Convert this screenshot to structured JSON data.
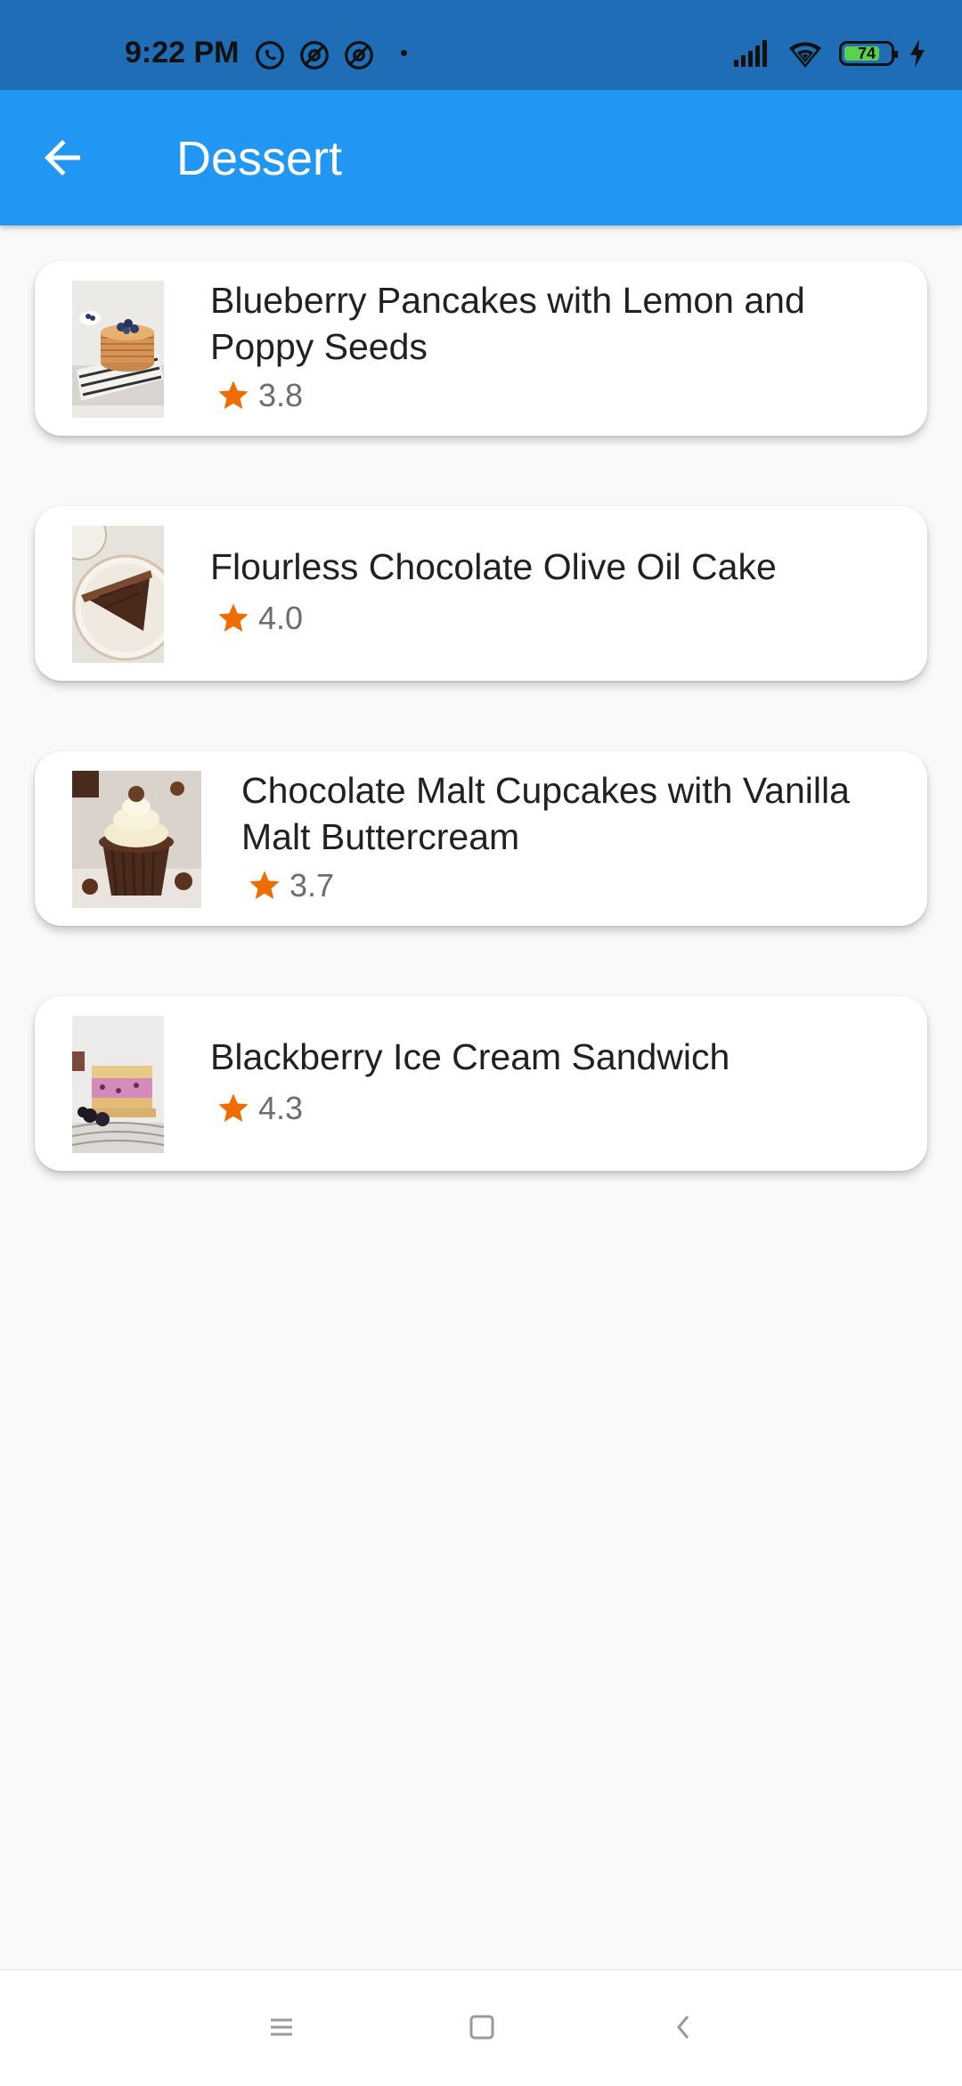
{
  "status_bar": {
    "time": "9:22 PM",
    "battery_level": "74",
    "icons": [
      "whatsapp-icon",
      "at-icon",
      "at-icon",
      "signal-icon",
      "wifi-icon",
      "battery-icon",
      "charging-icon"
    ]
  },
  "app_bar": {
    "title": "Dessert",
    "back_icon": "arrow-left-icon"
  },
  "recipes": [
    {
      "title": "Blueberry Pancakes with Lemon and Poppy Seeds",
      "rating": "3.8",
      "image": "pancakes-thumbnail"
    },
    {
      "title": "Flourless Chocolate Olive Oil Cake",
      "rating": "4.0",
      "image": "chocolate-cake-thumbnail"
    },
    {
      "title": "Chocolate Malt Cupcakes with Vanilla Malt Buttercream",
      "rating": "3.7",
      "image": "cupcake-thumbnail"
    },
    {
      "title": "Blackberry Ice Cream Sandwich",
      "rating": "4.3",
      "image": "ice-cream-sandwich-thumbnail"
    }
  ],
  "colors": {
    "status_bar": "#1f6db6",
    "app_bar": "#2196f3",
    "star": "#ef6c00",
    "background": "#f9f9f9"
  },
  "nav_bar": {
    "icons": [
      "menu-icon",
      "home-icon",
      "back-icon"
    ]
  }
}
